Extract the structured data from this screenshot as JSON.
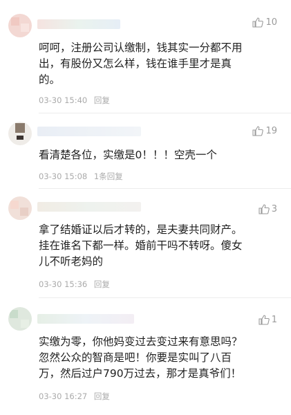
{
  "comments": [
    {
      "likes": "10",
      "text": "呵呵，注册公司认缴制，钱其实一分都不用\n出，有股份又怎么样，钱在谁手里才是真\n的。",
      "time": "03-30 15:40",
      "reply_label": "回复",
      "replies": ""
    },
    {
      "likes": "19",
      "text": "看清楚各位，实缴是0！！！空壳一个",
      "time": "03-30 15:08",
      "reply_label": "1条回复",
      "replies": ""
    },
    {
      "likes": "3",
      "text": "拿了结婚证以后才转的，是夫妻共同财产。\n挂在谁名下都一样。婚前干吗不转呀。傻女\n儿不听老妈的",
      "time": "03-30 15:36",
      "reply_label": "回复",
      "replies": ""
    },
    {
      "likes": "1",
      "text": "实缴为零，你他妈变过去变过来有意思吗？\n忽然公众的智商是吧！你要是实叫了八百\n万，然后过户790万过去，那才是真爷们！",
      "time": "03-30 16:27",
      "reply_label": "回复",
      "replies": ""
    }
  ]
}
